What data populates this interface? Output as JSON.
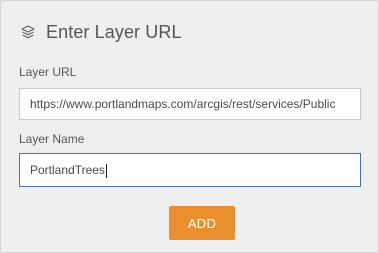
{
  "header": {
    "title": "Enter Layer URL",
    "icon": "layers-icon"
  },
  "layer_url": {
    "label": "Layer URL",
    "value": "https://www.portlandmaps.com/arcgis/rest/services/Public"
  },
  "layer_name": {
    "label": "Layer Name",
    "value": "PortlandTrees"
  },
  "add_button": {
    "label": "ADD"
  },
  "colors": {
    "panel_bg": "#efefef",
    "accent": "#ea8f2e",
    "focus_border": "#4a6fa5",
    "text": "#555555"
  }
}
